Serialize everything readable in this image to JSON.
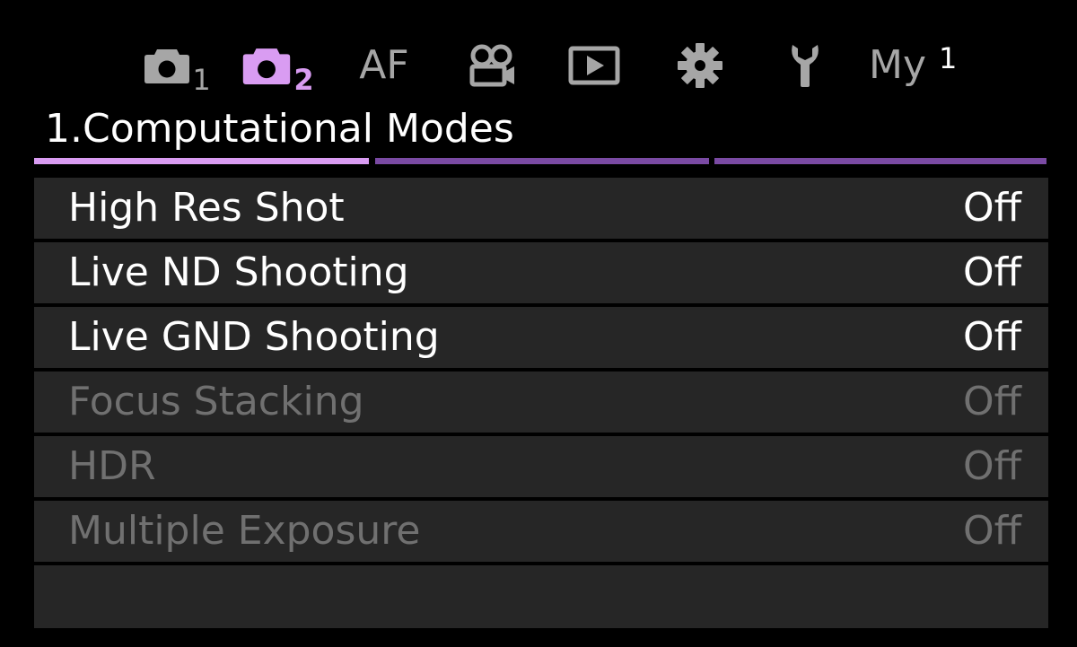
{
  "tabs": {
    "shooting1": {
      "icon": "camera-icon",
      "sub": "1"
    },
    "shooting2": {
      "icon": "camera-icon",
      "sub": "2"
    },
    "af": {
      "label": "AF"
    },
    "video": {
      "icon": "video-camera-icon"
    },
    "playback": {
      "icon": "playback-icon"
    },
    "custom": {
      "icon": "gear-icon"
    },
    "setup": {
      "icon": "wrench-icon"
    },
    "my": {
      "label": "My",
      "num": "1"
    }
  },
  "page": {
    "title": "1.Computational Modes",
    "current_page": 1,
    "total_pages": 3
  },
  "menu": {
    "items": [
      {
        "label": "High Res Shot",
        "value": "Off",
        "enabled": true
      },
      {
        "label": "Live ND Shooting",
        "value": "Off",
        "enabled": true
      },
      {
        "label": "Live GND Shooting",
        "value": "Off",
        "enabled": true
      },
      {
        "label": "Focus Stacking",
        "value": "Off",
        "enabled": false
      },
      {
        "label": "HDR",
        "value": "Off",
        "enabled": false
      },
      {
        "label": "Multiple Exposure",
        "value": "Off",
        "enabled": false
      }
    ]
  },
  "colors": {
    "background": "#000000",
    "row": "#262626",
    "accent": "#d99cf2",
    "indicator_inactive": "#7a4aa3",
    "tab_inactive": "#a6a6a6",
    "text": "#ffffff",
    "text_disabled": "#707070"
  }
}
